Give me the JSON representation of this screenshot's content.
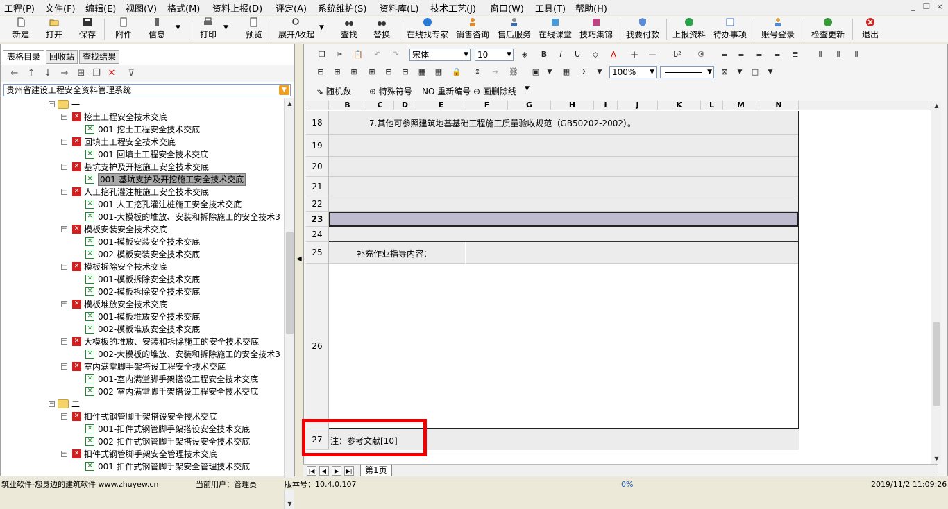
{
  "menu": [
    "工程(P)",
    "文件(F)",
    "编辑(E)",
    "视图(V)",
    "格式(M)",
    "资料上报(D)",
    "评定(A)",
    "系统维护(S)",
    "资料库(L)",
    "技术工艺(J)",
    "窗口(W)",
    "工具(T)",
    "帮助(H)"
  ],
  "window_controls": [
    "_",
    "❐",
    "×"
  ],
  "toolbar": [
    "新建",
    "打开",
    "保存",
    "附件",
    "信息",
    "打印",
    "预览",
    "展开/收起",
    "查找",
    "替换",
    "在线找专家",
    "销售咨询",
    "售后服务",
    "在线课堂",
    "技巧集锦",
    "我要付款",
    "上报资料",
    "待办事项",
    "账号登录",
    "检查更新",
    "退出"
  ],
  "left_tabs": [
    "表格目录",
    "回收站",
    "查找结果"
  ],
  "system_select": "贵州省建设工程安全资料管理系统",
  "tree": [
    {
      "level": 0,
      "type": "folder",
      "label": "一"
    },
    {
      "level": 1,
      "type": "x",
      "label": "挖土工程安全技术交底"
    },
    {
      "level": 2,
      "type": "doc",
      "label": "001-挖土工程安全技术交底"
    },
    {
      "level": 1,
      "type": "x",
      "label": "回填土工程安全技术交底"
    },
    {
      "level": 2,
      "type": "doc",
      "label": "001-回填土工程安全技术交底"
    },
    {
      "level": 1,
      "type": "x",
      "label": "基坑支护及开挖施工安全技术交底"
    },
    {
      "level": 2,
      "type": "doc",
      "label": "001-基坑支护及开挖施工安全技术交底",
      "selected": true
    },
    {
      "level": 1,
      "type": "x",
      "label": "人工挖孔灌注桩施工安全技术交底"
    },
    {
      "level": 2,
      "type": "doc",
      "label": "001-人工挖孔灌注桩施工安全技术交底"
    },
    {
      "level": 2,
      "type": "doc",
      "label": "001-大模板的堆放、安装和拆除施工的安全技术3"
    },
    {
      "level": 1,
      "type": "x",
      "label": "模板安装安全技术交底"
    },
    {
      "level": 2,
      "type": "doc",
      "label": "001-模板安装安全技术交底"
    },
    {
      "level": 2,
      "type": "doc",
      "label": "002-模板安装安全技术交底"
    },
    {
      "level": 1,
      "type": "x",
      "label": "模板拆除安全技术交底"
    },
    {
      "level": 2,
      "type": "doc",
      "label": "001-模板拆除安全技术交底"
    },
    {
      "level": 2,
      "type": "doc",
      "label": "002-模板拆除安全技术交底"
    },
    {
      "level": 1,
      "type": "x",
      "label": "模板堆放安全技术交底"
    },
    {
      "level": 2,
      "type": "doc",
      "label": "001-模板堆放安全技术交底"
    },
    {
      "level": 2,
      "type": "doc",
      "label": "002-模板堆放安全技术交底"
    },
    {
      "level": 1,
      "type": "x",
      "label": "大模板的堆放、安装和拆除施工的安全技术交底"
    },
    {
      "level": 2,
      "type": "doc",
      "label": "002-大模板的堆放、安装和拆除施工的安全技术3"
    },
    {
      "level": 1,
      "type": "x",
      "label": "室内满堂脚手架搭设工程安全技术交底"
    },
    {
      "level": 2,
      "type": "doc",
      "label": "001-室内满堂脚手架搭设工程安全技术交底"
    },
    {
      "level": 2,
      "type": "doc",
      "label": "002-室内满堂脚手架搭设工程安全技术交底"
    },
    {
      "level": 0,
      "type": "folder",
      "label": "二"
    },
    {
      "level": 1,
      "type": "x",
      "label": "扣件式钢管脚手架搭设安全技术交底"
    },
    {
      "level": 2,
      "type": "doc",
      "label": "001-扣件式钢管脚手架搭设安全技术交底"
    },
    {
      "level": 2,
      "type": "doc",
      "label": "002-扣件式钢管脚手架搭设安全技术交底"
    },
    {
      "level": 1,
      "type": "x",
      "label": "扣件式钢管脚手架安全管理技术交底"
    },
    {
      "level": 2,
      "type": "doc",
      "label": "001-扣件式钢管脚手架安全管理技术交底"
    }
  ],
  "format": {
    "font": "宋体",
    "size": "10",
    "zoom": "100%"
  },
  "extra_tools": [
    "随机数",
    "特殊符号",
    "重新编号",
    "画删除线"
  ],
  "columns": [
    "B",
    "C",
    "D",
    "E",
    "F",
    "G",
    "H",
    "I",
    "J",
    "K",
    "L",
    "M",
    "N"
  ],
  "rows": [
    {
      "num": "18",
      "text": "7.其他可参照建筑地基基础工程施工质量验收规范（GB50202-2002）。"
    },
    {
      "num": "19",
      "text": ""
    },
    {
      "num": "20",
      "text": ""
    },
    {
      "num": "21",
      "text": ""
    },
    {
      "num": "22",
      "text": ""
    },
    {
      "num": "23",
      "text": ""
    },
    {
      "num": "24",
      "text": ""
    },
    {
      "num": "25",
      "text": "补充作业指导内容："
    },
    {
      "num": "26",
      "text": ""
    },
    {
      "num": "27",
      "text": "注：参考文献[10]"
    }
  ],
  "sheet_tab": "第1页",
  "status": {
    "company": "筑业软件-您身边的建筑软件 www.zhuyew.cn",
    "user": "当前用户：管理员",
    "version": "版本号：10.4.0.107",
    "progress": "0%",
    "datetime": "2019/11/2 11:09:26"
  },
  "colors": {
    "highlight": "#f00000",
    "selected_row": "#c0bcd0"
  }
}
